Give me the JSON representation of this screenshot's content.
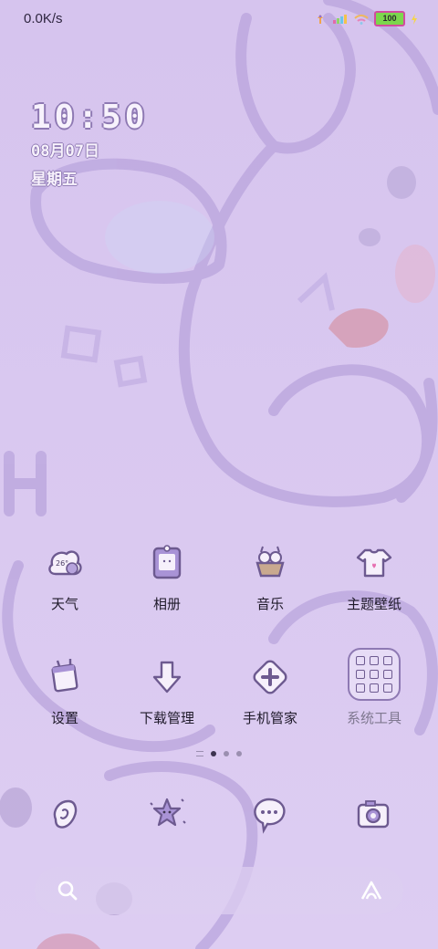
{
  "status_bar": {
    "net_speed": "0.0K/s",
    "battery_level": "100",
    "icons": [
      "usb-debug-icon",
      "sim-signal-icon",
      "wifi-icon",
      "battery-icon",
      "charging-icon"
    ]
  },
  "clock": {
    "time": "10:50",
    "date": "08月07日",
    "weekday": "星期五"
  },
  "home_grid": {
    "row1": [
      {
        "label": "天气",
        "icon": "weather-icon"
      },
      {
        "label": "相册",
        "icon": "gallery-icon"
      },
      {
        "label": "音乐",
        "icon": "music-icon"
      },
      {
        "label": "主题壁纸",
        "icon": "themes-icon"
      }
    ],
    "row2": [
      {
        "label": "设置",
        "icon": "settings-icon"
      },
      {
        "label": "下载管理",
        "icon": "download-icon"
      },
      {
        "label": "手机管家",
        "icon": "security-icon"
      },
      {
        "label": "系统工具",
        "icon": "folder-icon"
      }
    ],
    "weather_icon_text": "26°"
  },
  "page_indicator": {
    "pages": 3,
    "active": 0
  },
  "dock": {
    "apps": [
      "phone-icon",
      "browser-icon",
      "messages-icon",
      "camera-icon"
    ]
  },
  "search": {
    "icons": [
      "search-icon",
      "assistant-icon"
    ]
  },
  "colors": {
    "background": "#d9c8ef",
    "accent": "#8e79b3",
    "text": "#1f1a2a"
  }
}
